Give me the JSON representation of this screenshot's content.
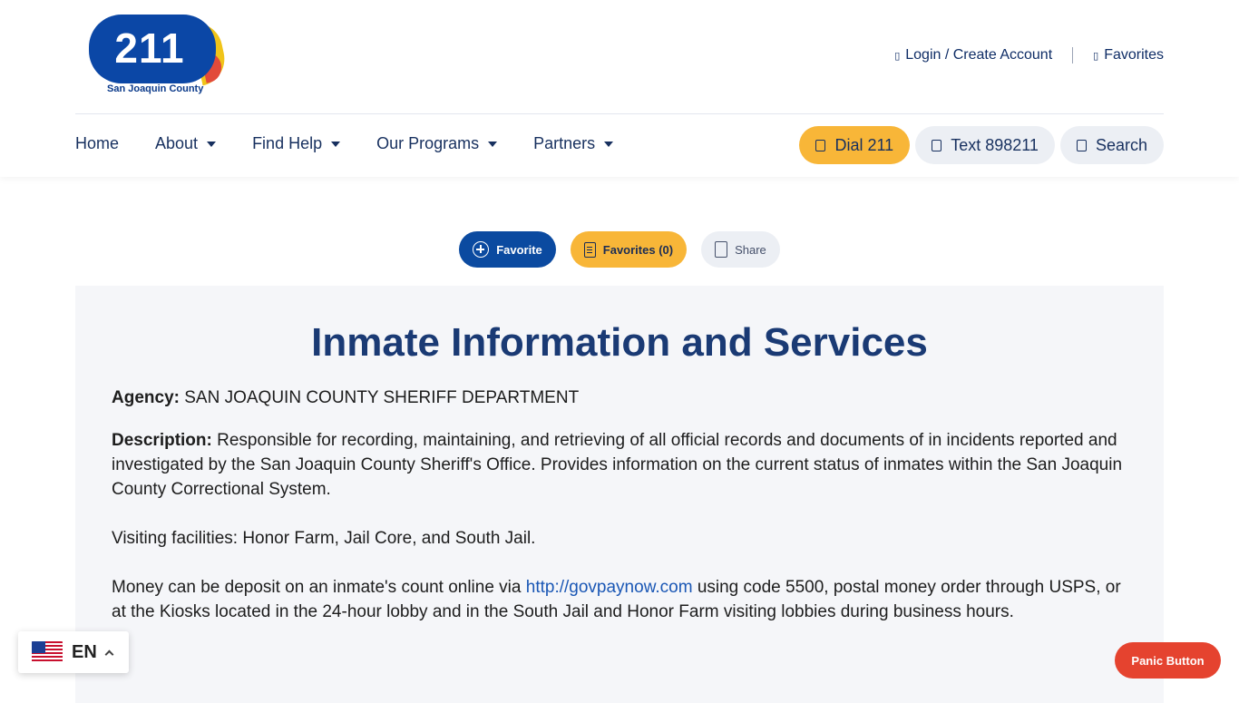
{
  "logo": {
    "number": "211",
    "county": "San Joaquin County"
  },
  "util_nav": {
    "login": "Login / Create Account",
    "favorites": "Favorites"
  },
  "nav": {
    "items": [
      {
        "label": "Home"
      },
      {
        "label": "About"
      },
      {
        "label": "Find Help"
      },
      {
        "label": "Our Programs"
      },
      {
        "label": "Partners"
      }
    ]
  },
  "quick": {
    "dial": "Dial 211",
    "text": "Text 898211",
    "search": "Search"
  },
  "actions": {
    "favorite": "Favorite",
    "favorites": "Favorites (0)",
    "share": "Share"
  },
  "page": {
    "title": "Inmate Information and Services",
    "agency_label": "Agency:",
    "agency_value": "SAN JOAQUIN COUNTY SHERIFF DEPARTMENT",
    "description_label": "Description:",
    "description_text": "Responsible for recording, maintaining, and retrieving of all official records and documents of in incidents reported and investigated by the San Joaquin County Sheriff's Office.  Provides information on the current status of inmates within the San Joaquin County Correctional System.",
    "visiting": "Visiting facilities: Honor Farm, Jail Core, and South Jail.",
    "money_before": "Money can be deposit on an inmate's count online via ",
    "money_link": "http://govpaynow.com",
    "money_after": " using code 5500, postal money order through USPS, or at the Kiosks located in the 24-hour lobby and in the South Jail and Honor Farm visiting lobbies during business hours."
  },
  "language": {
    "code": "EN"
  },
  "panic": {
    "label": "Panic Button"
  },
  "colors": {
    "brand_blue": "#0b47a6",
    "accent_yellow": "#f8b638",
    "title_blue": "#1a3a74",
    "panic_red": "#e5432f"
  }
}
